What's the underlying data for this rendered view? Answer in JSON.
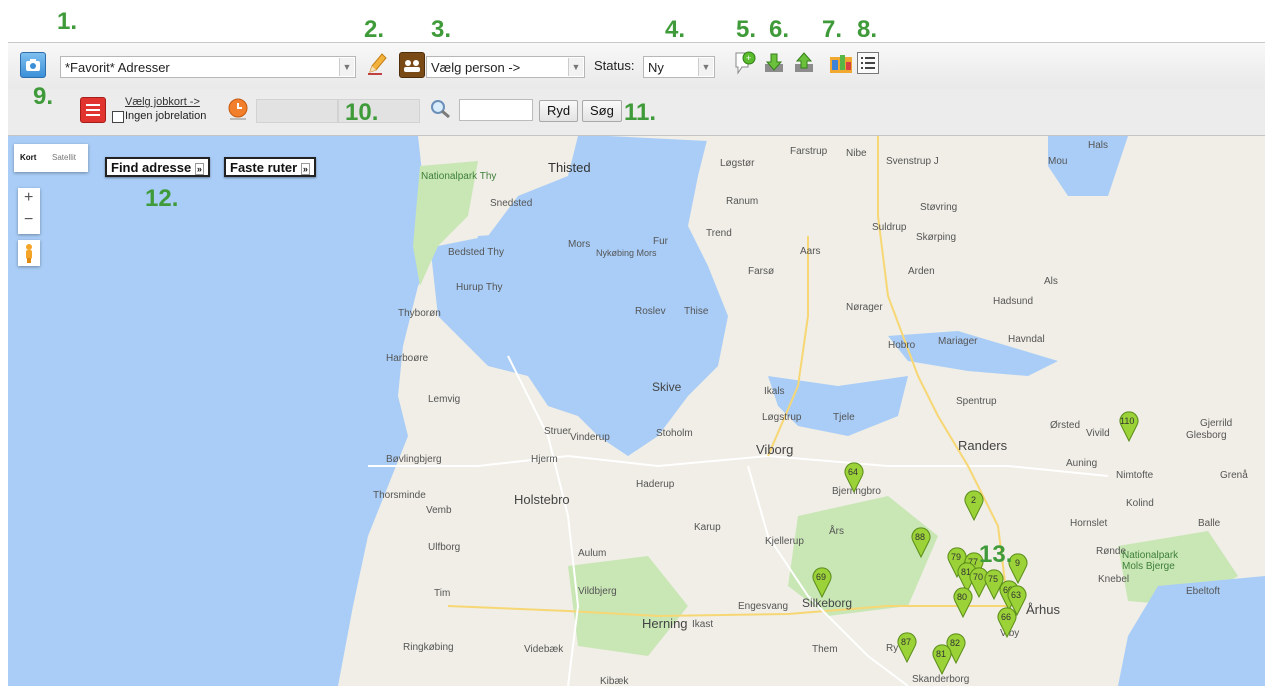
{
  "annotations": [
    "1.",
    "2.",
    "3.",
    "4.",
    "5.",
    "6.",
    "7.",
    "8.",
    "9.",
    "10.",
    "11.",
    "12.",
    "13."
  ],
  "toolbar": {
    "favorite_select": "*Favorit* Adresser",
    "person_select": "Vælg person ->",
    "status_label": "Status:",
    "status_value": "Ny"
  },
  "toolbar2": {
    "jobcard_link": "Vælg jobkort ->",
    "no_jobrelation_label": "Ingen jobrelation",
    "clear_button": "Ryd",
    "search_button": "Søg",
    "search_value": ""
  },
  "map": {
    "type_tabs": [
      "Kort",
      "Satellit"
    ],
    "zoom_in": "+",
    "zoom_out": "−",
    "find_address": "Find adresse",
    "fixed_routes": "Faste ruter",
    "places": [
      "Thisted",
      "Nationalpark Thy",
      "Snedsted",
      "Bedsted Thy",
      "Hurup Thy",
      "Thyborøn",
      "Harboøre",
      "Lemvig",
      "Bøvlingbjerg",
      "Thorsminde",
      "Vemb",
      "Ulfborg",
      "Tim",
      "Ringkøbing",
      "Mors",
      "Nykøbing Mors",
      "Fur",
      "Roslev",
      "Thise",
      "Skive",
      "Struer",
      "Vinderup",
      "Stoholm",
      "Hjerm",
      "Holstebro",
      "Haderup",
      "Aulum",
      "Vildbjerg",
      "Herning",
      "Ikast",
      "Videbæk",
      "Kibæk",
      "Karup",
      "Kjellerup",
      "Engesvang",
      "Silkeborg",
      "Them",
      "Ry",
      "Skanderborg",
      "Viborg",
      "Tjele",
      "Løgstrup",
      "Ikals",
      "Bjerringbro",
      "Års",
      "Løgstør",
      "Ranum",
      "Trend",
      "Farsø",
      "Aars",
      "Farstrup",
      "Nibe",
      "Svenstrup J",
      "Suldrup",
      "Støvring",
      "Skørping",
      "Arden",
      "Nørager",
      "Hobro",
      "Mariager",
      "Havndal",
      "Hadsund",
      "Als",
      "Mou",
      "Hals",
      "Randers",
      "Spentrup",
      "Ørsted",
      "Vivild",
      "Glesborg",
      "Gjerrild",
      "Auning",
      "Nimtofte",
      "Grenå",
      "Kolind",
      "Hornslet",
      "Balle",
      "Rønde",
      "Nationalpark Mols Bjerge",
      "Knebel",
      "Ebeltoft",
      "Århus",
      "Viby"
    ],
    "markers": [
      "110",
      "64",
      "2",
      "88",
      "79",
      "77",
      "81",
      "70",
      "75",
      "9",
      "69",
      "80",
      "60",
      "63",
      "66",
      "87",
      "82",
      "81"
    ]
  }
}
